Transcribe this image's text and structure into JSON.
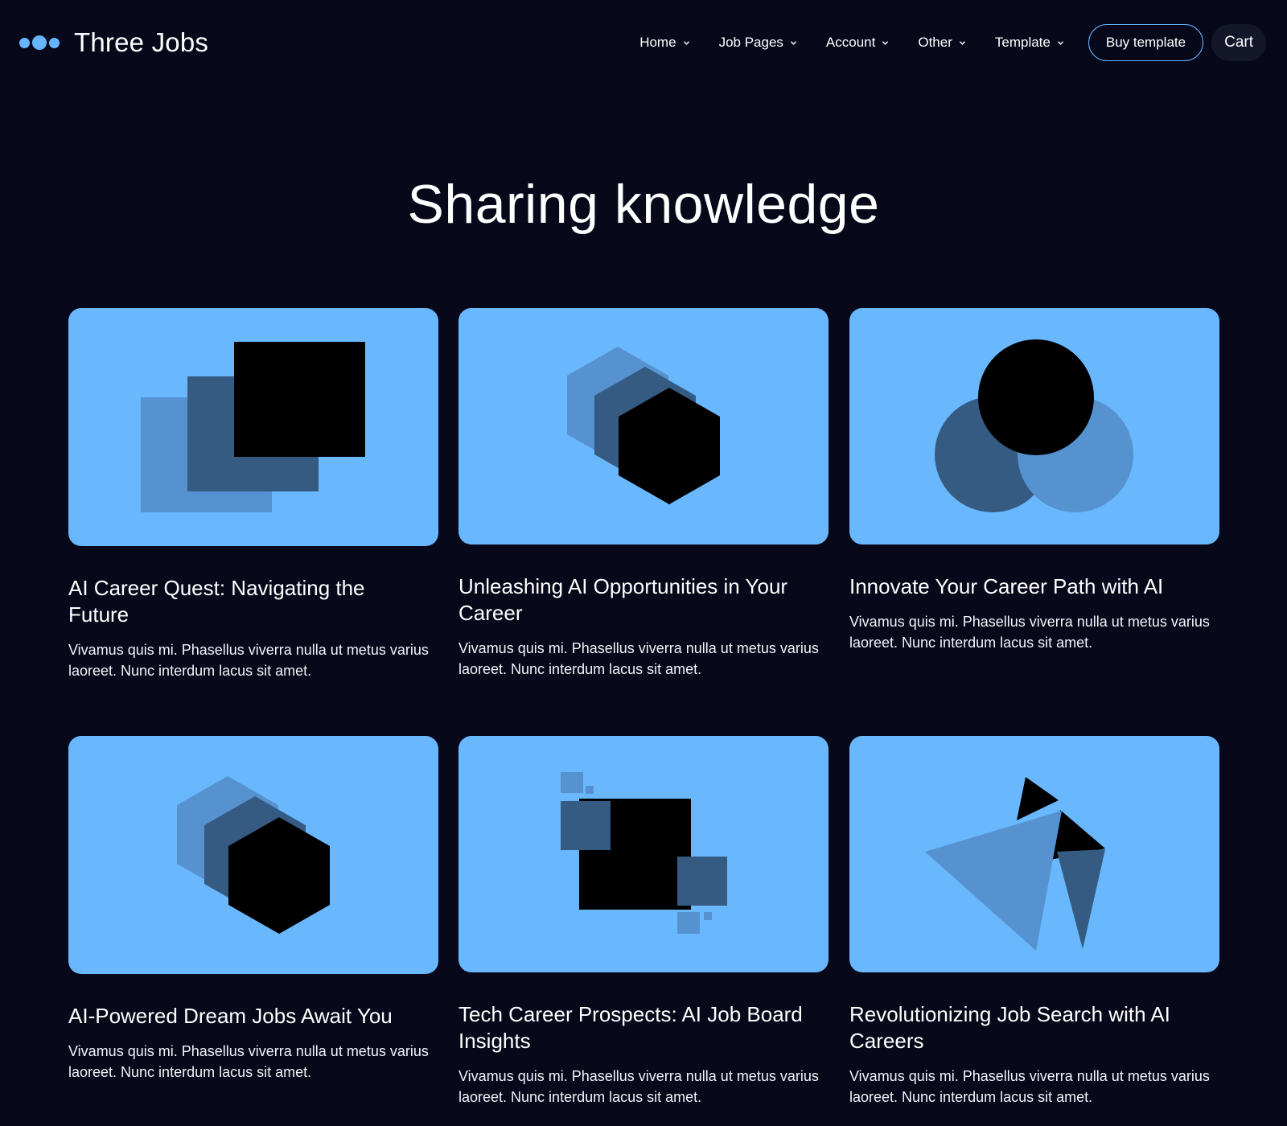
{
  "brand": {
    "name": "Three Jobs"
  },
  "nav": {
    "items": [
      {
        "label": "Home"
      },
      {
        "label": "Job Pages"
      },
      {
        "label": "Account"
      },
      {
        "label": "Other"
      },
      {
        "label": "Template"
      }
    ],
    "buy_label": "Buy template",
    "cart_label": "Cart"
  },
  "hero": {
    "title": "Sharing knowledge"
  },
  "cards": [
    {
      "title": "AI Career Quest: Navigating the Future",
      "text": "Vivamus quis mi. Phasellus viverra nulla ut metus varius laoreet. Nunc interdum lacus sit amet.",
      "icon": "stacked-squares-icon"
    },
    {
      "title": "Unleashing AI Opportunities in Your Career",
      "text": "Vivamus quis mi. Phasellus viverra nulla ut metus varius laoreet. Nunc interdum lacus sit amet.",
      "icon": "stacked-hexagons-icon"
    },
    {
      "title": "Innovate Your Career Path with AI",
      "text": "Vivamus quis mi. Phasellus viverra nulla ut metus varius laoreet. Nunc interdum lacus sit amet.",
      "icon": "circles-icon"
    },
    {
      "title": "AI-Powered Dream Jobs Await You",
      "text": "Vivamus quis mi. Phasellus viverra nulla ut metus varius laoreet. Nunc interdum lacus sit amet.",
      "icon": "stacked-hexagons-icon"
    },
    {
      "title": "Tech Career Prospects: AI Job Board Insights",
      "text": "Vivamus quis mi. Phasellus viverra nulla ut metus varius laoreet. Nunc interdum lacus sit amet.",
      "icon": "scattered-squares-icon"
    },
    {
      "title": "Revolutionizing Job Search with AI Careers",
      "text": "Vivamus quis mi. Phasellus viverra nulla ut metus varius laoreet. Nunc interdum lacus sit amet.",
      "icon": "triangles-icon"
    }
  ],
  "colors": {
    "background": "#07081a",
    "accent": "#66b5ff",
    "card_bg": "#69b7fd",
    "shape_mid": "#5592cf",
    "shape_dark": "#355b82",
    "shape_black": "#000000"
  }
}
